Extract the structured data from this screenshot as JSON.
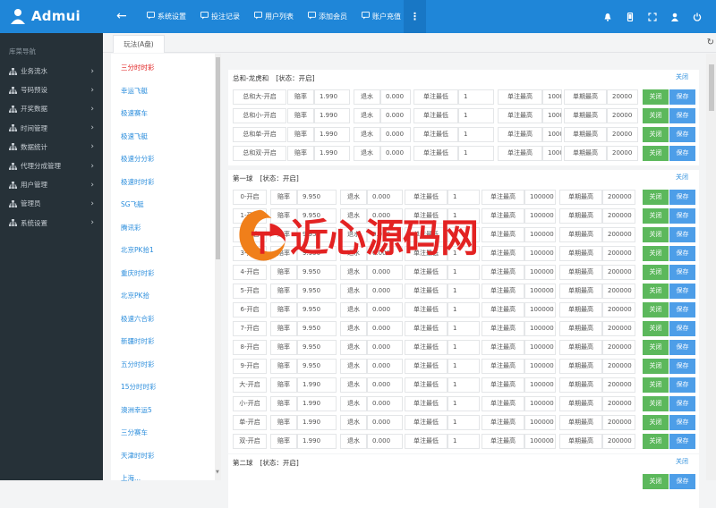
{
  "app": {
    "name": "Admui"
  },
  "topnav": [
    {
      "label": "系统设置",
      "icon": "comment-icon"
    },
    {
      "label": "投注记录",
      "icon": "comment-icon"
    },
    {
      "label": "用户列表",
      "icon": "comment-icon"
    },
    {
      "label": "添加会员",
      "icon": "comment-icon"
    },
    {
      "label": "账户充值",
      "icon": "comment-icon"
    }
  ],
  "more_label": "⋮",
  "topbar_right_icons": [
    "bell-icon",
    "mobile-icon",
    "fullscreen-icon",
    "user-icon",
    "power-icon"
  ],
  "sidebar": {
    "title": "库菜导航",
    "items": [
      {
        "label": "业务流水",
        "icon": "sitemap-icon"
      },
      {
        "label": "号码预设",
        "icon": "sitemap-icon"
      },
      {
        "label": "开奖数据",
        "icon": "sitemap-icon"
      },
      {
        "label": "时间管理",
        "icon": "sitemap-icon"
      },
      {
        "label": "数据统计",
        "icon": "sitemap-icon"
      },
      {
        "label": "代理分成管理",
        "icon": "sitemap-icon"
      },
      {
        "label": "用户管理",
        "icon": "sitemap-icon"
      },
      {
        "label": "管理员",
        "icon": "sitemap-icon"
      },
      {
        "label": "系统设置",
        "icon": "sitemap-icon"
      }
    ]
  },
  "tab": {
    "label": "玩法(A盘)"
  },
  "games": [
    "三分时时彩",
    "幸运飞艇",
    "极速赛车",
    "极速飞艇",
    "极速分分彩",
    "极速时时彩",
    "SG飞艇",
    "腾讯彩",
    "北京PK拾1",
    "重庆时时彩",
    "北京PK拾",
    "极速六合彩",
    "新疆时时彩",
    "五分时时彩",
    "15分时时彩",
    "澳洲幸运5",
    "三分赛车",
    "天津时时彩",
    "上海..."
  ],
  "active_game_index": 0,
  "labels": {
    "rate": "赔率",
    "rebate": "退水",
    "min": "单注最低",
    "max": "单注最高",
    "period_max": "单期最高",
    "close": "关闭",
    "save": "保存"
  },
  "sections": [
    {
      "title": "总和-龙虎和",
      "status": "[状态：开启]",
      "close_link": "关闭",
      "rows": [
        {
          "name": "总和大-开启",
          "rate": "1.990",
          "rebate": "0.000",
          "min": "1",
          "max": "10000",
          "period": "20000"
        },
        {
          "name": "总和小-开启",
          "rate": "1.990",
          "rebate": "0.000",
          "min": "1",
          "max": "10000",
          "period": "20000"
        },
        {
          "name": "总和单-开启",
          "rate": "1.990",
          "rebate": "0.000",
          "min": "1",
          "max": "10000",
          "period": "20000"
        },
        {
          "name": "总和双-开启",
          "rate": "1.990",
          "rebate": "0.000",
          "min": "1",
          "max": "10000",
          "period": "20000"
        }
      ]
    },
    {
      "title": "第一球",
      "status": "[状态：开启]",
      "close_link": "关闭",
      "rows": [
        {
          "name": "0-开启",
          "rate": "9.950",
          "rebate": "0.000",
          "min": "1",
          "max": "100000",
          "period": "200000"
        },
        {
          "name": "1-开启",
          "rate": "9.950",
          "rebate": "0.000",
          "min": "1",
          "max": "100000",
          "period": "200000"
        },
        {
          "name": "2-开启",
          "rate": "9.950",
          "rebate": "0.000",
          "min": "1",
          "max": "100000",
          "period": "200000"
        },
        {
          "name": "3-开启",
          "rate": "9.950",
          "rebate": "0.000",
          "min": "1",
          "max": "100000",
          "period": "200000"
        },
        {
          "name": "4-开启",
          "rate": "9.950",
          "rebate": "0.000",
          "min": "1",
          "max": "100000",
          "period": "200000"
        },
        {
          "name": "5-开启",
          "rate": "9.950",
          "rebate": "0.000",
          "min": "1",
          "max": "100000",
          "period": "200000"
        },
        {
          "name": "6-开启",
          "rate": "9.950",
          "rebate": "0.000",
          "min": "1",
          "max": "100000",
          "period": "200000"
        },
        {
          "name": "7-开启",
          "rate": "9.950",
          "rebate": "0.000",
          "min": "1",
          "max": "100000",
          "period": "200000"
        },
        {
          "name": "8-开启",
          "rate": "9.950",
          "rebate": "0.000",
          "min": "1",
          "max": "100000",
          "period": "200000"
        },
        {
          "name": "9-开启",
          "rate": "9.950",
          "rebate": "0.000",
          "min": "1",
          "max": "100000",
          "period": "200000"
        },
        {
          "name": "大-开启",
          "rate": "1.990",
          "rebate": "0.000",
          "min": "1",
          "max": "100000",
          "period": "200000"
        },
        {
          "name": "小-开启",
          "rate": "1.990",
          "rebate": "0.000",
          "min": "1",
          "max": "100000",
          "period": "200000"
        },
        {
          "name": "单-开启",
          "rate": "1.990",
          "rebate": "0.000",
          "min": "1",
          "max": "100000",
          "period": "200000"
        },
        {
          "name": "双-开启",
          "rate": "1.990",
          "rebate": "0.000",
          "min": "1",
          "max": "100000",
          "period": "200000"
        }
      ]
    },
    {
      "title": "第二球",
      "status": "[状态：开启]",
      "close_link": "关闭",
      "rows": []
    }
  ],
  "watermark": {
    "text": "近心源码网",
    "logo": "flame-logo"
  },
  "colors": {
    "topbar": "#1f86d8",
    "sidebar": "#263138",
    "close_btn": "#5cb85c",
    "save_btn": "#4d9ee8",
    "active_game": "#e02020",
    "link": "#2c8edc"
  }
}
